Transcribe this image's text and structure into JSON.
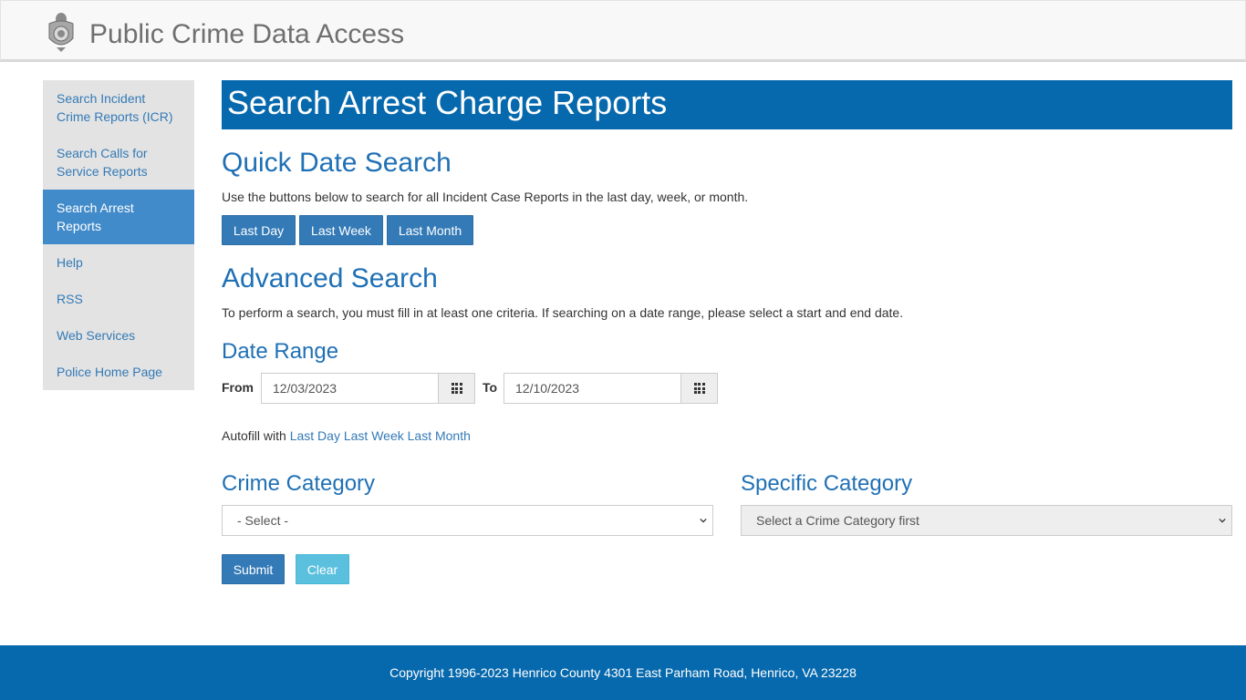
{
  "header": {
    "title": "Public Crime Data Access",
    "logo_icon": "police-badge-icon"
  },
  "sidebar": {
    "items": [
      {
        "label": "Search Incident Crime Reports (ICR)",
        "active": false
      },
      {
        "label": "Search Calls for Service Reports",
        "active": false
      },
      {
        "label": "Search Arrest Reports",
        "active": true
      },
      {
        "label": "Help",
        "active": false
      },
      {
        "label": "RSS",
        "active": false
      },
      {
        "label": "Web Services",
        "active": false
      },
      {
        "label": "Police Home Page",
        "active": false
      }
    ]
  },
  "main": {
    "page_title": "Search Arrest Charge Reports",
    "quick": {
      "title": "Quick Date Search",
      "description": "Use the buttons below to search for all Incident Case Reports in the last day, week, or month.",
      "buttons": [
        "Last Day",
        "Last Week",
        "Last Month"
      ]
    },
    "advanced": {
      "title": "Advanced Search",
      "description": "To perform a search, you must fill in at least one criteria. If searching on a date range, please select a start and end date."
    },
    "date_range": {
      "title": "Date Range",
      "from_label": "From",
      "from_value": "12/03/2023",
      "to_label": "To",
      "to_value": "12/10/2023",
      "calendar_icon": "calendar-grid-icon"
    },
    "autofill": {
      "prefix": "Autofill with",
      "links": [
        "Last Day",
        "Last Week",
        "Last Month"
      ]
    },
    "crime_category": {
      "title": "Crime Category",
      "selected": "- Select -"
    },
    "specific_category": {
      "title": "Specific Category",
      "selected": "Select a Crime Category first"
    },
    "actions": {
      "submit_label": "Submit",
      "clear_label": "Clear"
    }
  },
  "footer": {
    "text": "Copyright 1996-2023 Henrico County 4301 East Parham Road, Henrico, VA 23228"
  },
  "colors": {
    "banner": "#0769ad",
    "heading": "#1f70b5",
    "link": "#337ab7",
    "button": "#337ab7",
    "clear_button": "#5bc0de",
    "sidebar_bg": "#e3e3e3",
    "sidebar_active": "#428bca"
  }
}
